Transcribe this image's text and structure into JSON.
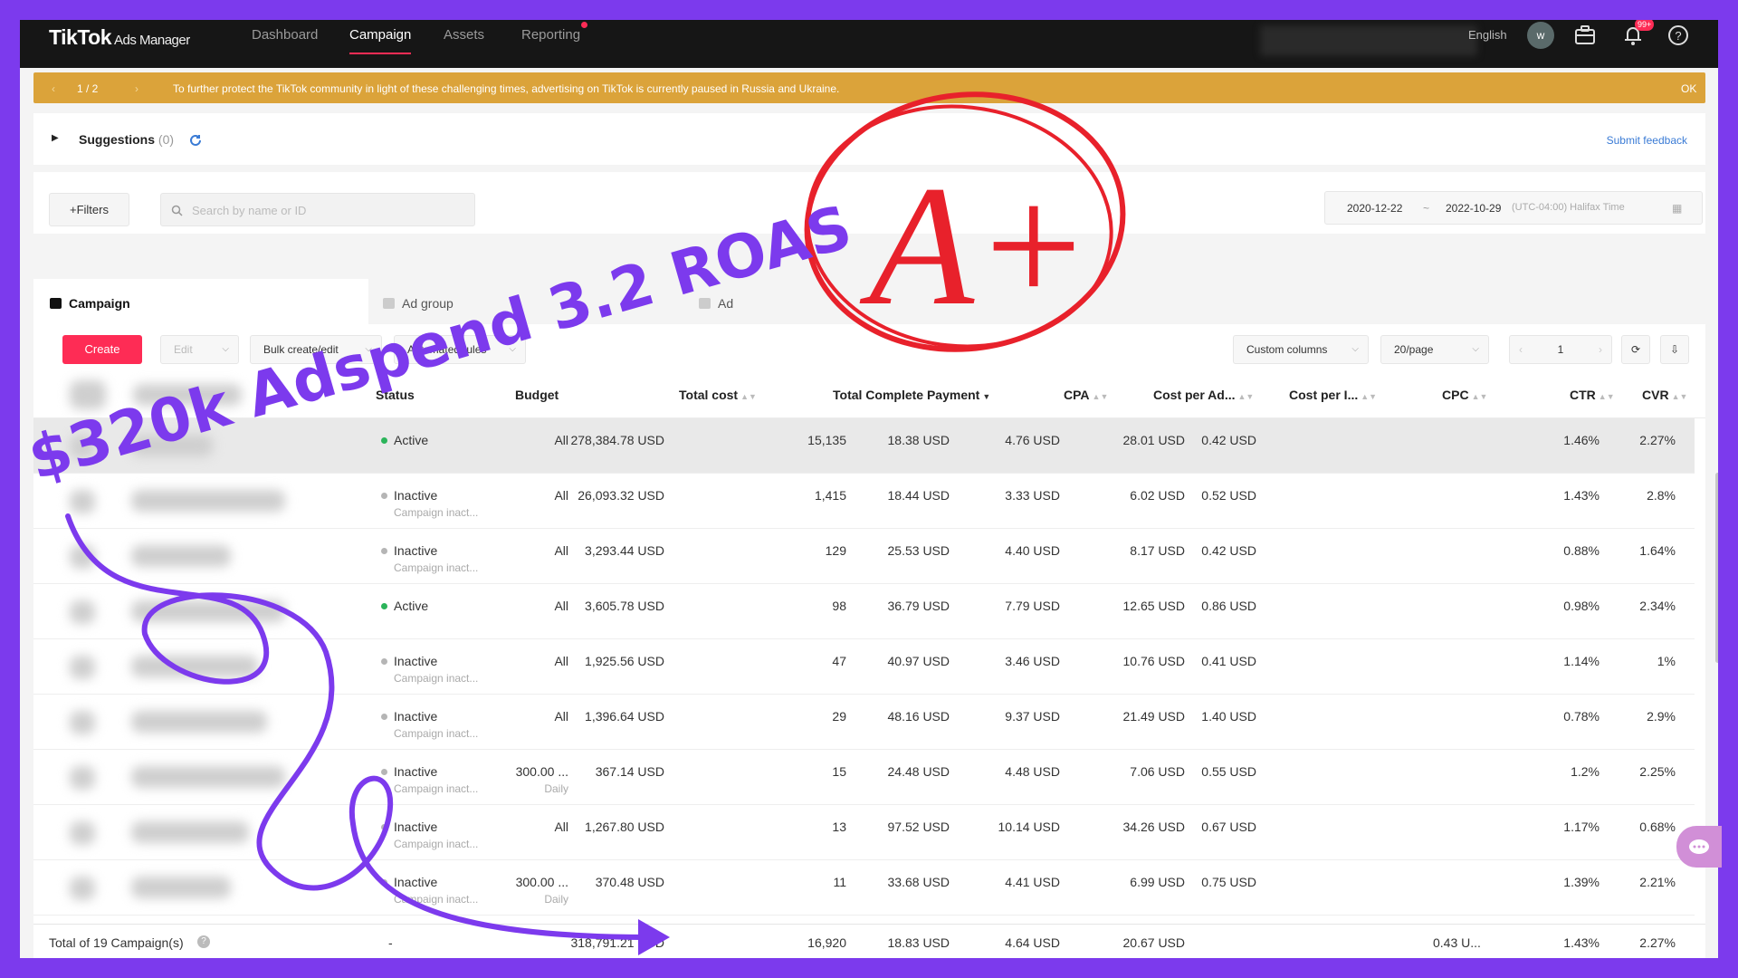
{
  "nav": {
    "brand": "TikTok",
    "brand_sub": "Ads Manager",
    "links": [
      "Dashboard",
      "Campaign",
      "Assets",
      "Reporting"
    ],
    "active": "Campaign",
    "language": "English",
    "avatar": "w",
    "notif_badge": "99+"
  },
  "banner": {
    "pager": "1 / 2",
    "message": "To further protect the TikTok community in light of these challenging times, advertising on TikTok is currently paused in Russia and Ukraine.",
    "ok": "OK"
  },
  "suggestions": {
    "label": "Suggestions",
    "count": "(0)",
    "feedback": "Submit feedback"
  },
  "filters": {
    "button": "+Filters",
    "search_placeholder": "Search by name or ID",
    "start_date": "2020-12-22",
    "separator": "~",
    "end_date": "2022-10-29",
    "timezone": "(UTC-04:00) Halifax Time"
  },
  "tabs": [
    "Campaign",
    "Ad group",
    "Ad"
  ],
  "toolbar": {
    "create": "Create",
    "edit": "Edit",
    "bulk": "Bulk create/edit",
    "automated": "Automated rules",
    "custom_columns": "Custom columns",
    "per_page": "20/page",
    "page": "1"
  },
  "columns": [
    "Status",
    "Budget",
    "Total cost",
    "Total Complete Payment",
    "CPA",
    "Cost per Ad...",
    "Cost per I...",
    "CPC",
    "CTR",
    "CVR"
  ],
  "rows": [
    {
      "status": "Active",
      "sub": "",
      "budget": "All",
      "budget_sub": "",
      "cost": "278,384.78 USD",
      "payments": "15,135",
      "cpa": "18.38 USD",
      "cpad": "4.76 USD",
      "cpi": "28.01 USD",
      "cpc": "0.42 USD",
      "ctr": "1.46%",
      "cvr": "2.27%"
    },
    {
      "status": "Inactive",
      "sub": "Campaign inact...",
      "budget": "All",
      "budget_sub": "",
      "cost": "26,093.32 USD",
      "payments": "1,415",
      "cpa": "18.44 USD",
      "cpad": "3.33 USD",
      "cpi": "6.02 USD",
      "cpc": "0.52 USD",
      "ctr": "1.43%",
      "cvr": "2.8%"
    },
    {
      "status": "Inactive",
      "sub": "Campaign inact...",
      "budget": "All",
      "budget_sub": "",
      "cost": "3,293.44 USD",
      "payments": "129",
      "cpa": "25.53 USD",
      "cpad": "4.40 USD",
      "cpi": "8.17 USD",
      "cpc": "0.42 USD",
      "ctr": "0.88%",
      "cvr": "1.64%"
    },
    {
      "status": "Active",
      "sub": "",
      "budget": "All",
      "budget_sub": "",
      "cost": "3,605.78 USD",
      "payments": "98",
      "cpa": "36.79 USD",
      "cpad": "7.79 USD",
      "cpi": "12.65 USD",
      "cpc": "0.86 USD",
      "ctr": "0.98%",
      "cvr": "2.34%"
    },
    {
      "status": "Inactive",
      "sub": "Campaign inact...",
      "budget": "All",
      "budget_sub": "",
      "cost": "1,925.56 USD",
      "payments": "47",
      "cpa": "40.97 USD",
      "cpad": "3.46 USD",
      "cpi": "10.76 USD",
      "cpc": "0.41 USD",
      "ctr": "1.14%",
      "cvr": "1%"
    },
    {
      "status": "Inactive",
      "sub": "Campaign inact...",
      "budget": "All",
      "budget_sub": "",
      "cost": "1,396.64 USD",
      "payments": "29",
      "cpa": "48.16 USD",
      "cpad": "9.37 USD",
      "cpi": "21.49 USD",
      "cpc": "1.40 USD",
      "ctr": "0.78%",
      "cvr": "2.9%"
    },
    {
      "status": "Inactive",
      "sub": "Campaign inact...",
      "budget": "300.00 ...",
      "budget_sub": "Daily",
      "cost": "367.14 USD",
      "payments": "15",
      "cpa": "24.48 USD",
      "cpad": "4.48 USD",
      "cpi": "7.06 USD",
      "cpc": "0.55 USD",
      "ctr": "1.2%",
      "cvr": "2.25%"
    },
    {
      "status": "Inactive",
      "sub": "Campaign inact...",
      "budget": "All",
      "budget_sub": "",
      "cost": "1,267.80 USD",
      "payments": "13",
      "cpa": "97.52 USD",
      "cpad": "10.14 USD",
      "cpi": "34.26 USD",
      "cpc": "0.67 USD",
      "ctr": "1.17%",
      "cvr": "0.68%"
    },
    {
      "status": "Inactive",
      "sub": "Campaign inact...",
      "budget": "300.00 ...",
      "budget_sub": "Daily",
      "cost": "370.48 USD",
      "payments": "11",
      "cpa": "33.68 USD",
      "cpad": "4.41 USD",
      "cpi": "6.99 USD",
      "cpc": "0.75 USD",
      "ctr": "1.39%",
      "cvr": "2.21%"
    }
  ],
  "total": {
    "label": "Total of 19 Campaign(s)",
    "budget": "-",
    "cost": "318,791.21 USD",
    "payments": "16,920",
    "cpa": "18.83 USD",
    "cpad": "4.64 USD",
    "cpi": "20.67 USD",
    "cpc": "0.43 U...",
    "ctr": "1.43%",
    "cvr": "2.27%"
  },
  "overlay": {
    "headline": "$320k Adspend 3.2 ROAS",
    "grade": "A+"
  },
  "colors": {
    "accent": "#fe2c55",
    "banner": "#dba33a",
    "active_dot": "#2bb45a",
    "inactive_dot": "#b5b5b5",
    "annotation_purple": "#7c3aed",
    "grade_red": "#e8212b"
  }
}
